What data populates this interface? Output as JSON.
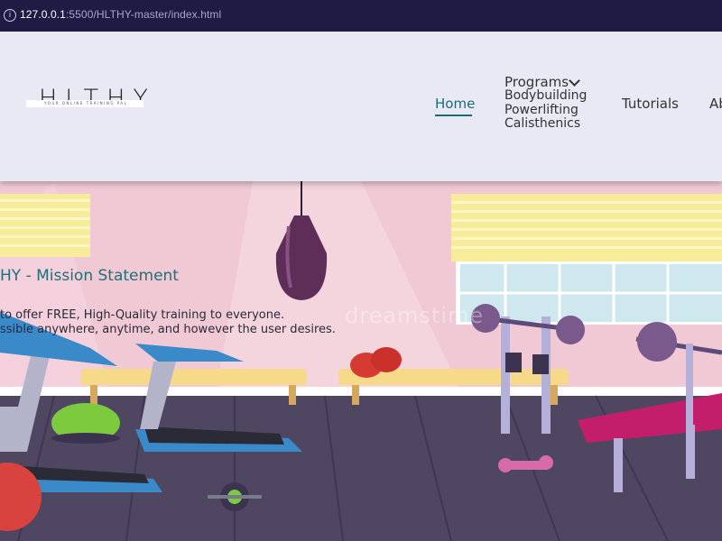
{
  "browser": {
    "info_icon": "info-icon",
    "url_host": "127.0.0.1",
    "url_path": ":5500/HLTHY-master/index.html"
  },
  "header": {
    "logo_text": "HLTHY",
    "logo_tagline": "YOUR ONLINE TRAINING PAL",
    "nav": {
      "home": "Home",
      "programs": "Programs",
      "programs_items": [
        "Bodybuilding",
        "Powerlifting",
        "Calisthenics"
      ],
      "tutorials": "Tutorials",
      "about": "Ab"
    },
    "accent_color": "#1a6d75"
  },
  "hero": {
    "title": "HY - Mission Statement",
    "line1": "to offer FREE, High-Quality training to everyone.",
    "line2": "ssible anywhere, anytime, and however the user desires.",
    "watermark": "dreamstime"
  }
}
